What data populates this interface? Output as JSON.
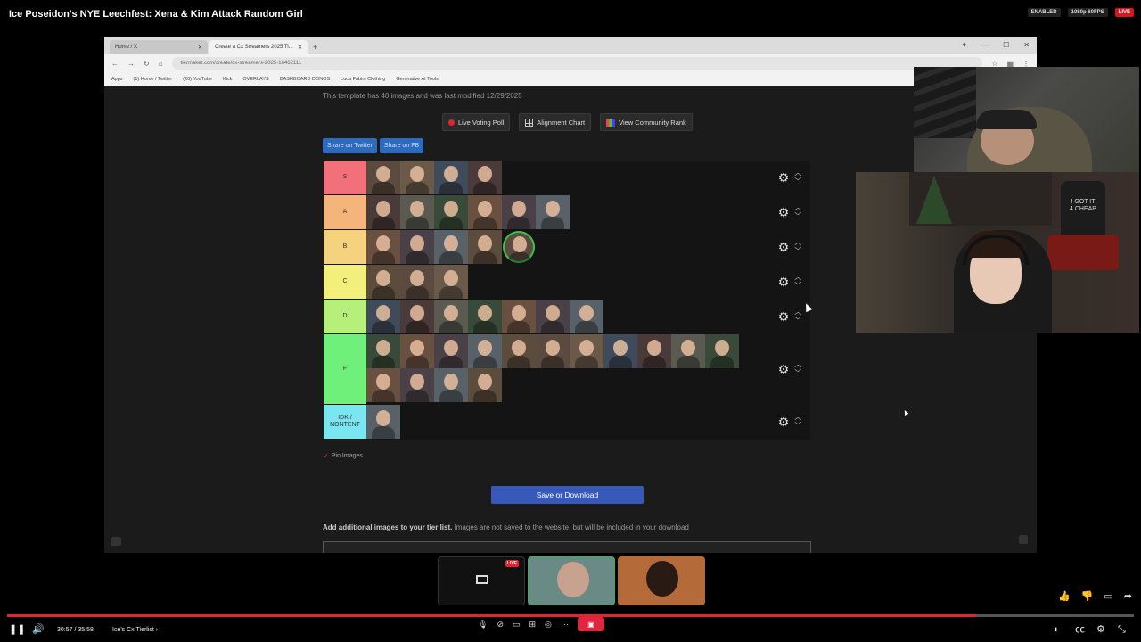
{
  "video": {
    "title": "Ice Poseidon's NYE Leechfest: Xena & Kim Attack Random Girl",
    "badge_enabled": "ENABLED",
    "badge_quality": "1080p 60FPS",
    "badge_live": "LIVE"
  },
  "browser": {
    "tabs": [
      {
        "label": "Home / X"
      },
      {
        "label": "Create a Cx Streamers 2025 Ti..."
      }
    ],
    "url": "tiermaker.com/create/cx-streamers-2025-16462111",
    "bookmarks": [
      "Apps",
      "(1) Home / Twitter",
      "(20) YouTube",
      "Kick",
      "OVERLAYS",
      "DASHBOARD DONOS",
      "Luca Fabini Clothing",
      "Generative AI Tools"
    ]
  },
  "page": {
    "template_info": "This template has 40 images and was last modified 12/29/2025",
    "buttons": {
      "voting": "Live Voting Poll",
      "alignment": "Alignment Chart",
      "community": "View Community Rank"
    },
    "share_twitter": "Share on Twitter",
    "share_fb": "Share on FB",
    "pin_images": "Pin Images",
    "save": "Save or Download",
    "add_images_bold": "Add additional images to your tier list.",
    "add_images_rest": " Images are not saved to the website, but will be included in your download"
  },
  "tiers": [
    {
      "label": "S",
      "color": "#f2707a",
      "count": 4
    },
    {
      "label": "A",
      "color": "#f5b47a",
      "count": 6
    },
    {
      "label": "B",
      "color": "#f5d27e",
      "count": 5
    },
    {
      "label": "C",
      "color": "#f2f07a",
      "count": 3
    },
    {
      "label": "D",
      "color": "#b6f07a",
      "count": 7
    },
    {
      "label": "F",
      "color": "#6ff07a",
      "count": 15
    },
    {
      "label": "IDK / NONTENT",
      "color": "#7ae6f2",
      "count": 1
    }
  ],
  "player": {
    "time": "30:57 / 35:58",
    "chapter": "Ice's Cx Tierlist",
    "progress_fraction": 0.86,
    "live_tile": "LIVE"
  },
  "hoodie_text": "I GOT IT 4 CHEAP"
}
